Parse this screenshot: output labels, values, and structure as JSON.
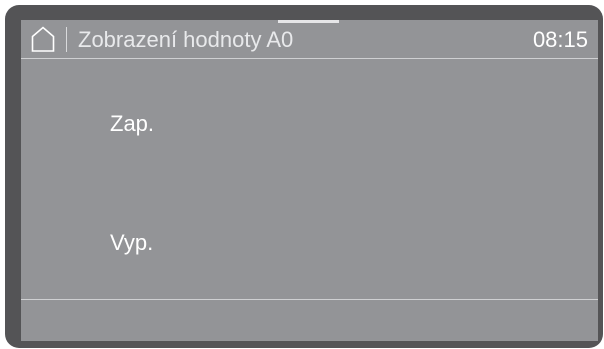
{
  "header": {
    "home_icon": "home-icon",
    "title": "Zobrazení hodnoty A0",
    "time": "08:15"
  },
  "options": {
    "on_label": "Zap.",
    "off_label": "Vyp."
  },
  "colors": {
    "bezel": "#545456",
    "screen": "#939497",
    "text": "#ffffff"
  }
}
